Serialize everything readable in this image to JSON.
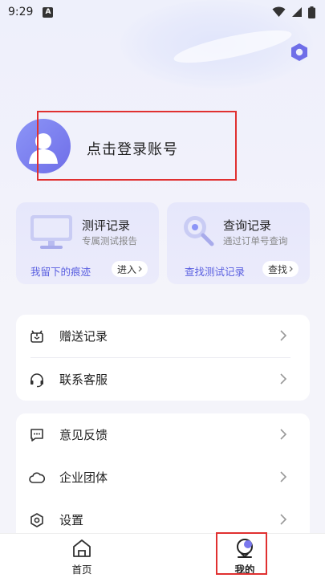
{
  "status_bar": {
    "time": "9:29",
    "notification_badge": "A"
  },
  "profile": {
    "login_prompt": "点击登录账号"
  },
  "cards": [
    {
      "title": "测评记录",
      "subtitle": "专属测试报告",
      "bottom_text": "我留下的痕迹",
      "action": "进入",
      "icon": "monitor-icon"
    },
    {
      "title": "查询记录",
      "subtitle": "通过订单号查询",
      "bottom_text": "查找测试记录",
      "action": "查找",
      "icon": "magnifier-icon"
    }
  ],
  "menu_group_1": [
    {
      "label": "赠送记录",
      "icon": "gift-icon"
    },
    {
      "label": "联系客服",
      "icon": "headset-icon"
    }
  ],
  "menu_group_2": [
    {
      "label": "意见反馈",
      "icon": "feedback-icon"
    },
    {
      "label": "企业团体",
      "icon": "cloud-icon"
    },
    {
      "label": "设置",
      "icon": "settings-icon"
    }
  ],
  "bottom_nav": [
    {
      "label": "首页",
      "icon": "home-icon",
      "active": false
    },
    {
      "label": "我的",
      "icon": "mine-icon",
      "active": true
    }
  ],
  "colors": {
    "accent": "#6f6ee8",
    "highlight_box": "#e03030",
    "link": "#5a5fe0"
  }
}
